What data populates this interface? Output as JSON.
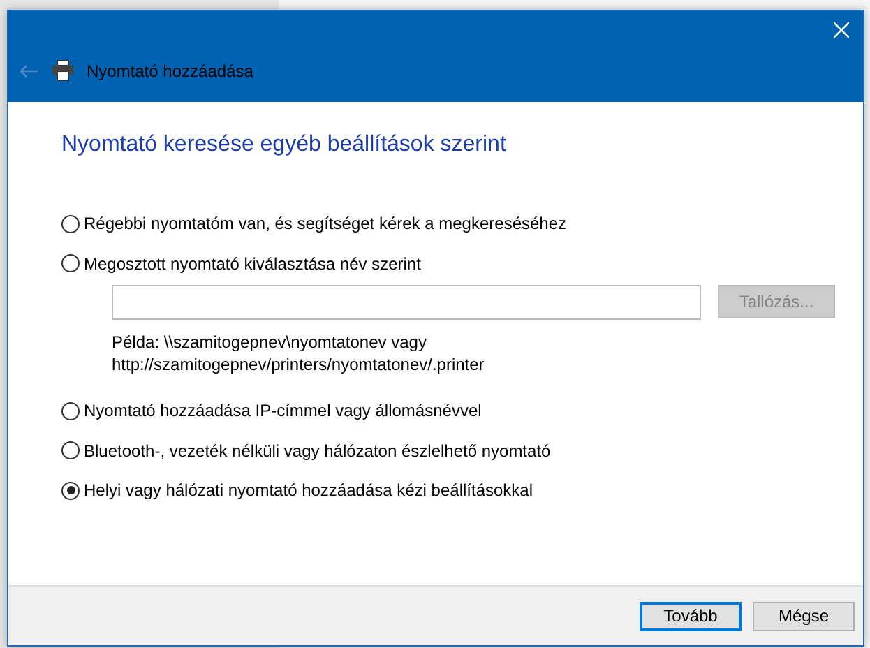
{
  "window": {
    "title": "Nyomtató hozzáadása"
  },
  "heading": "Nyomtató keresése egyéb beállítások szerint",
  "options": [
    {
      "label": "Régebbi nyomtatóm van, és segítséget kérek a megkereséséhez",
      "selected": false
    },
    {
      "label": "Megosztott nyomtató kiválasztása név szerint",
      "selected": false,
      "kind": "share"
    },
    {
      "label": "Nyomtató hozzáadása IP-címmel vagy állomásnévvel",
      "selected": false
    },
    {
      "label": "Bluetooth-, vezeték nélküli vagy hálózaton észlelhető nyomtató",
      "selected": false
    },
    {
      "label": "Helyi vagy hálózati nyomtató hozzáadása kézi beállításokkal",
      "selected": true
    }
  ],
  "share": {
    "browse_button": {
      "label": "Tallózás...",
      "disabled": true
    },
    "example_lines": [
      "Példa: \\\\szamitogepnev\\nyomtatonev vagy",
      "http://szamitogepnev/printers/nyomtatonev/.printer"
    ]
  },
  "buttons": [
    {
      "label": "Tovább",
      "default": true
    },
    {
      "label": "Mégse",
      "default": false
    }
  ]
}
